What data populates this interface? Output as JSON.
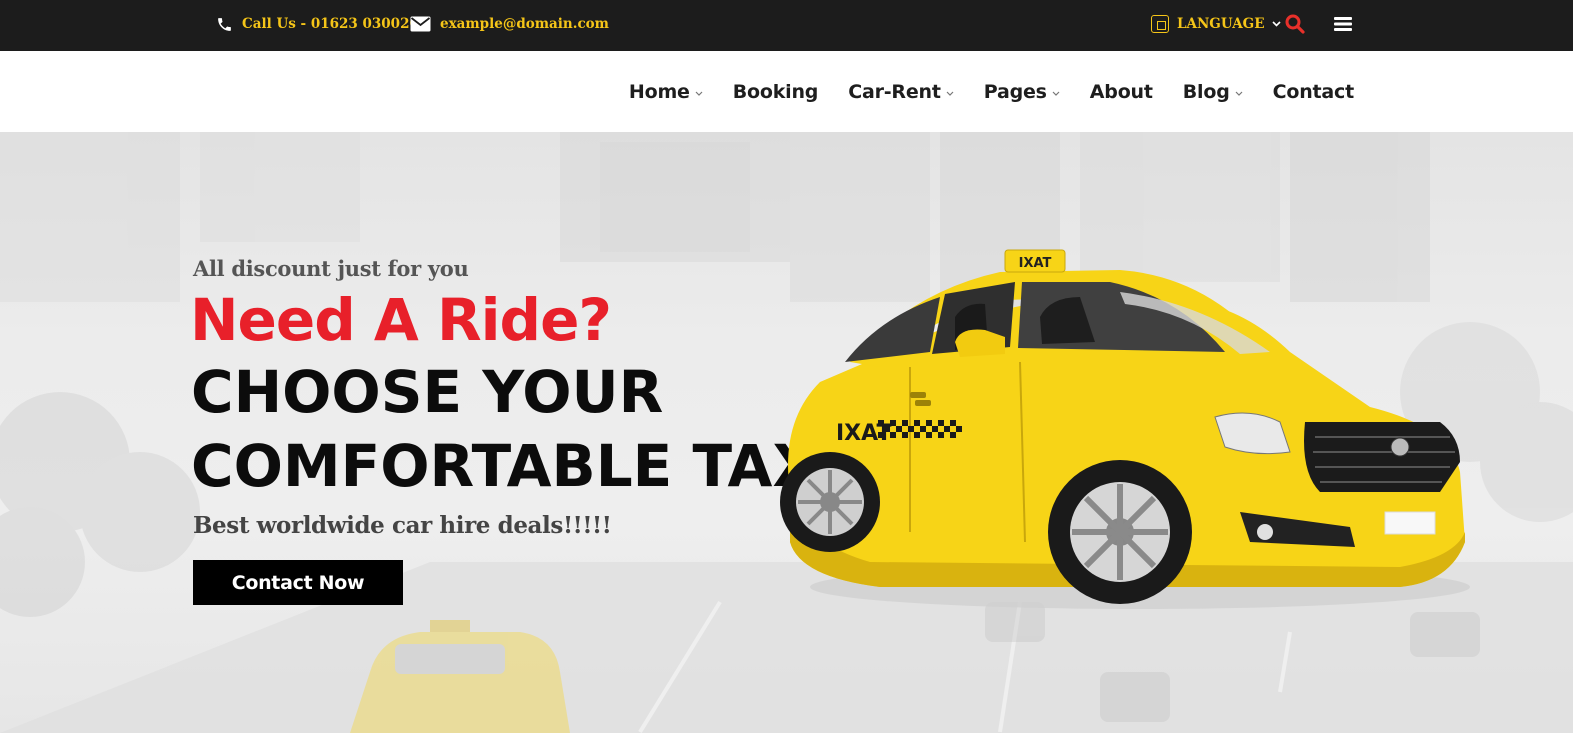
{
  "topbar": {
    "phone_icon": "phone-icon",
    "phone_label": "Call Us - 01623 030020",
    "email_icon": "envelope-icon",
    "email_label": "example@domain.com",
    "language_icon": "translate-icon",
    "language_label": "LANGUAGE",
    "search_icon": "search-icon",
    "menu_icon": "hamburger-menu-icon"
  },
  "nav": {
    "items": [
      {
        "label": "Home",
        "dropdown": true
      },
      {
        "label": "Booking",
        "dropdown": false
      },
      {
        "label": "Car-Rent",
        "dropdown": true
      },
      {
        "label": "Pages",
        "dropdown": true
      },
      {
        "label": "About",
        "dropdown": false
      },
      {
        "label": "Blog",
        "dropdown": true
      },
      {
        "label": "Contact",
        "dropdown": false
      }
    ]
  },
  "hero": {
    "subtitle": "All discount just for you",
    "title": "Need A Ride?",
    "headline_line1": "CHOOSE YOUR",
    "headline_line2": "COMFORTABLE TAXI",
    "tagline": "Best worldwide car hire deals!!!!!",
    "cta_label": "Contact Now",
    "taxi_sign_text": "IXAT",
    "taxi_door_text": "IXAT"
  },
  "colors": {
    "topbar_bg": "#1c1c1c",
    "topbar_text": "#f5c518",
    "search_icon": "#e8302a",
    "title_red": "#e8202a",
    "headline_black": "#0c0c0c",
    "taxi_yellow": "#f7d417",
    "button_bg": "#000000"
  }
}
